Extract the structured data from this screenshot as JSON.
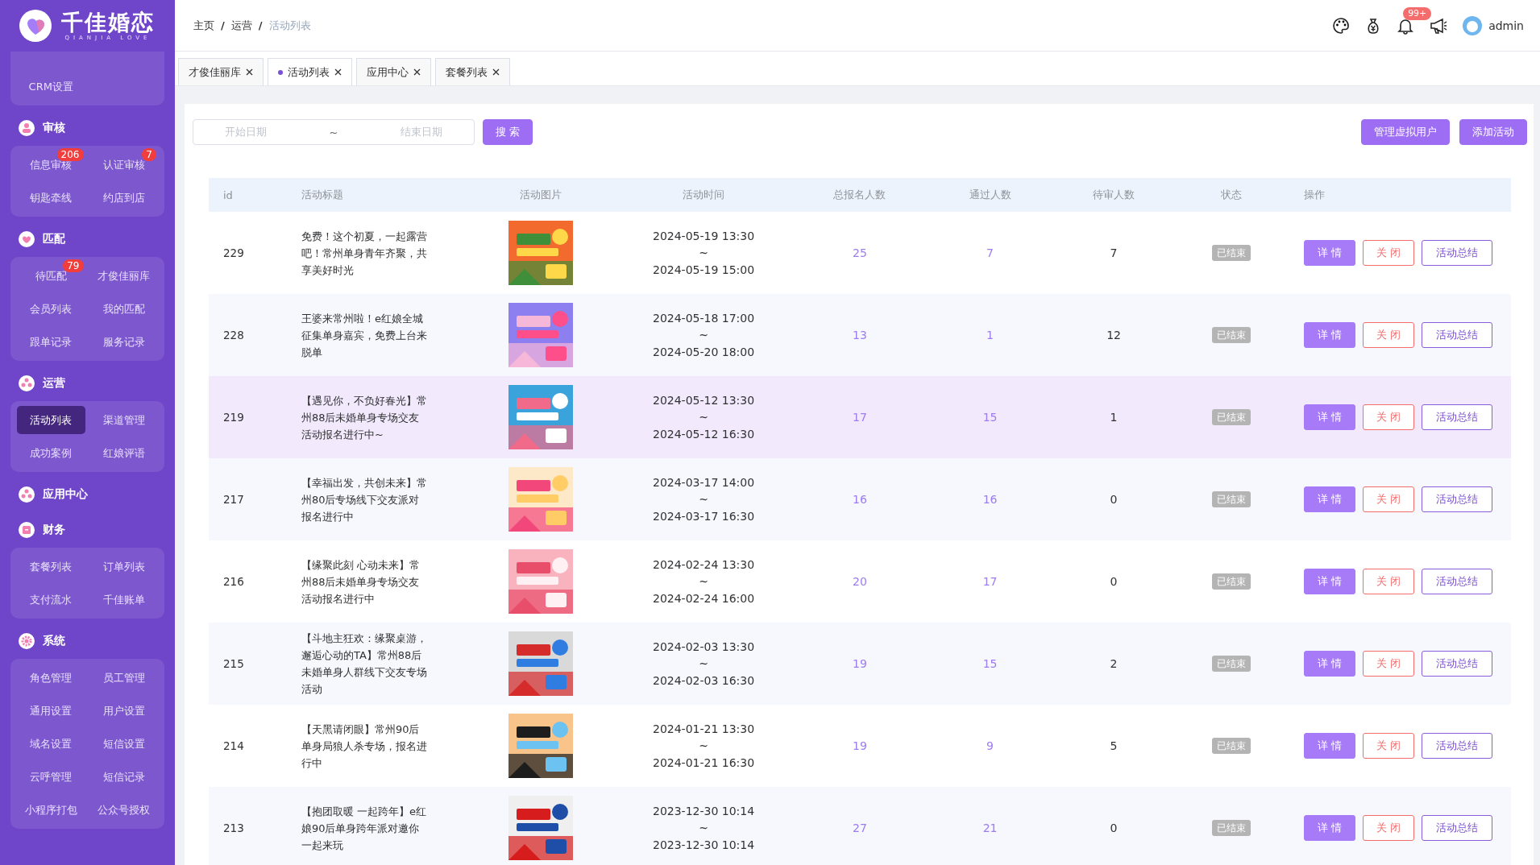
{
  "logo": {
    "title": "千佳婚恋",
    "subtitle": "QIANJIA LOVE"
  },
  "sidebar": {
    "groups": [
      {
        "items": [
          {
            "label": "CRM设置",
            "selected": false
          }
        ]
      },
      {
        "title": "审核",
        "items": [
          {
            "label": "信息审核",
            "selected": false,
            "badge": "206"
          },
          {
            "label": "认证审核",
            "selected": false,
            "badge": "7"
          },
          {
            "label": "钥匙牵线",
            "selected": false
          },
          {
            "label": "约店到店",
            "selected": false
          }
        ]
      },
      {
        "title": "匹配",
        "items": [
          {
            "label": "待匹配",
            "selected": false,
            "badge": "79"
          },
          {
            "label": "才俊佳丽库",
            "selected": false
          },
          {
            "label": "会员列表",
            "selected": false
          },
          {
            "label": "我的匹配",
            "selected": false
          },
          {
            "label": "跟单记录",
            "selected": false
          },
          {
            "label": "服务记录",
            "selected": false
          }
        ]
      },
      {
        "title": "运营",
        "items": [
          {
            "label": "活动列表",
            "selected": true
          },
          {
            "label": "渠道管理",
            "selected": false
          },
          {
            "label": "成功案例",
            "selected": false
          },
          {
            "label": "红娘评语",
            "selected": false
          }
        ]
      },
      {
        "title": "应用中心"
      },
      {
        "title": "财务",
        "items": [
          {
            "label": "套餐列表",
            "selected": false
          },
          {
            "label": "订单列表",
            "selected": false
          },
          {
            "label": "支付流水",
            "selected": false
          },
          {
            "label": "千佳账单",
            "selected": false
          }
        ]
      },
      {
        "title": "系统",
        "items": [
          {
            "label": "角色管理",
            "selected": false
          },
          {
            "label": "员工管理",
            "selected": false
          },
          {
            "label": "通用设置",
            "selected": false
          },
          {
            "label": "用户设置",
            "selected": false
          },
          {
            "label": "域名设置",
            "selected": false
          },
          {
            "label": "短信设置",
            "selected": false
          },
          {
            "label": "云呼管理",
            "selected": false
          },
          {
            "label": "短信记录",
            "selected": false
          },
          {
            "label": "小程序打包",
            "selected": false
          },
          {
            "label": "公众号授权",
            "selected": false
          }
        ]
      }
    ]
  },
  "breadcrumb": [
    "主页",
    "运营",
    "活动列表"
  ],
  "breadcrumb_separator": "/",
  "header": {
    "notification_badge": "99+",
    "user": "admin"
  },
  "tabs": [
    {
      "label": "才俊佳丽库",
      "selected": false
    },
    {
      "label": "活动列表",
      "selected": true
    },
    {
      "label": "应用中心",
      "selected": false
    },
    {
      "label": "套餐列表",
      "selected": false
    }
  ],
  "filter": {
    "start_placeholder": "开始日期",
    "separator": "~",
    "end_placeholder": "结束日期",
    "search_button": "搜 索"
  },
  "actions": [
    "管理虚拟用户",
    "添加活动"
  ],
  "table": {
    "columns": [
      "id",
      "活动标题",
      "活动图片",
      "活动时间",
      "总报名人数",
      "通过人数",
      "待审人数",
      "状态",
      "操作"
    ],
    "rows": [
      {
        "id": "229",
        "title": "免费！这个初夏，一起露营吧！常州单身青年齐聚，共享美好时光",
        "start": "2024-05-19 13:30",
        "separator": "~",
        "end": "2024-05-19 15:00",
        "total": "25",
        "passed": "7",
        "pending": "7",
        "status": "已结束",
        "hovered": false,
        "actions": [
          "详 情",
          "关 闭",
          "活动总结"
        ]
      },
      {
        "id": "228",
        "title": "王婆来常州啦！e红娘全城征集单身嘉宾，免费上台来脱单",
        "start": "2024-05-18 17:00",
        "separator": "~",
        "end": "2024-05-20 18:00",
        "total": "13",
        "passed": "1",
        "pending": "12",
        "status": "已结束",
        "hovered": false,
        "actions": [
          "详 情",
          "关 闭",
          "活动总结"
        ]
      },
      {
        "id": "219",
        "title": "【遇见你，不负好春光】常州88后未婚单身专场交友活动报名进行中~",
        "start": "2024-05-12 13:30",
        "separator": "~",
        "end": "2024-05-12 16:30",
        "total": "17",
        "passed": "15",
        "pending": "1",
        "status": "已结束",
        "hovered": true,
        "actions": [
          "详 情",
          "关 闭",
          "活动总结"
        ]
      },
      {
        "id": "217",
        "title": "【幸福出发，共创未来】常州80后专场线下交友派对报名进行中",
        "start": "2024-03-17 14:00",
        "separator": "~",
        "end": "2024-03-17 16:30",
        "total": "16",
        "passed": "16",
        "pending": "0",
        "status": "已结束",
        "hovered": false,
        "actions": [
          "详 情",
          "关 闭",
          "活动总结"
        ]
      },
      {
        "id": "216",
        "title": "【缘聚此刻 心动未来】常州88后未婚单身专场交友活动报名进行中",
        "start": "2024-02-24 13:30",
        "separator": "~",
        "end": "2024-02-24 16:00",
        "total": "20",
        "passed": "17",
        "pending": "0",
        "status": "已结束",
        "hovered": false,
        "actions": [
          "详 情",
          "关 闭",
          "活动总结"
        ]
      },
      {
        "id": "215",
        "title": "【斗地主狂欢：缘聚桌游，邂逅心动的TA】常州88后未婚单身人群线下交友专场活动",
        "start": "2024-02-03 13:30",
        "separator": "~",
        "end": "2024-02-03 16:30",
        "total": "19",
        "passed": "15",
        "pending": "2",
        "status": "已结束",
        "hovered": false,
        "actions": [
          "详 情",
          "关 闭",
          "活动总结"
        ]
      },
      {
        "id": "214",
        "title": "【天黑请闭眼】常州90后单身局狼人杀专场，报名进行中",
        "start": "2024-01-21 13:30",
        "separator": "~",
        "end": "2024-01-21 16:30",
        "total": "19",
        "passed": "9",
        "pending": "5",
        "status": "已结束",
        "hovered": false,
        "actions": [
          "详 情",
          "关 闭",
          "活动总结"
        ]
      },
      {
        "id": "213",
        "title": "【抱团取暖 一起跨年】e红娘90后单身跨年派对邀你一起来玩",
        "start": "2023-12-30 10:14",
        "separator": "~",
        "end": "2023-12-30 10:14",
        "total": "27",
        "passed": "21",
        "pending": "0",
        "status": "已结束",
        "hovered": false,
        "actions": [
          "详 情",
          "关 闭",
          "活动总结"
        ]
      }
    ]
  }
}
